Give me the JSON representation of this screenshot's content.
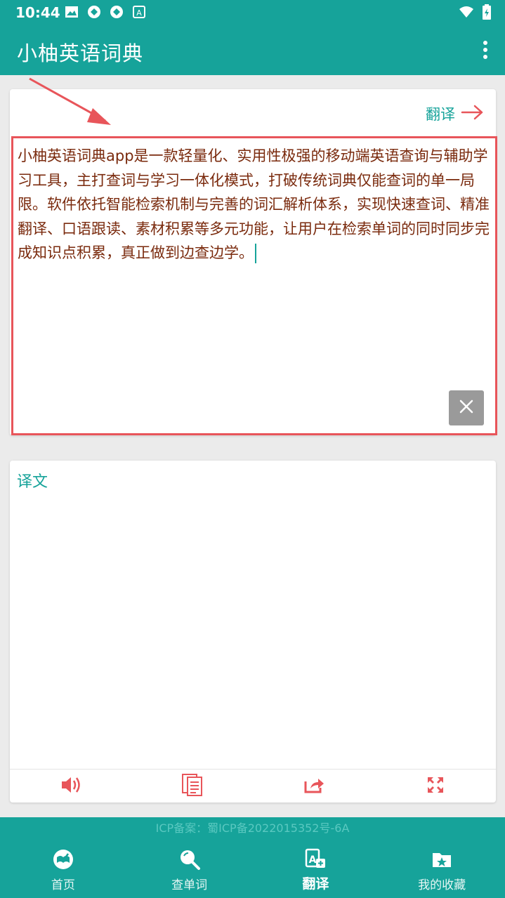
{
  "status_bar": {
    "time": "10:44"
  },
  "app_bar": {
    "title": "小柚英语词典"
  },
  "translate_card": {
    "translate_label": "翻译",
    "input_text": "小柚英语词典app是一款轻量化、实用性极强的移动端英语查询与辅助学习工具，主打查词与学习一体化模式，打破传统词典仅能查词的单一局限。软件依托智能检索机制与完善的词汇解析体系，实现快速查词、精准翻译、口语跟读、素材积累等多元功能，让用户在检索单词的同时同步完成知识点积累，真正做到边查边学。"
  },
  "result_card": {
    "label": "译文"
  },
  "footer": {
    "icp": "ICP备案：蜀ICP备2022015352号-6A"
  },
  "bottom_nav": {
    "items": [
      {
        "label": "首页",
        "icon": "home-book-icon"
      },
      {
        "label": "查单词",
        "icon": "search-icon"
      },
      {
        "label": "翻译",
        "icon": "translate-icon"
      },
      {
        "label": "我的收藏",
        "icon": "favorites-folder-icon"
      }
    ],
    "active": "翻译"
  },
  "colors": {
    "primary": "#16a39a",
    "accent": "#e8555a",
    "input_text": "#7a2a0d"
  }
}
